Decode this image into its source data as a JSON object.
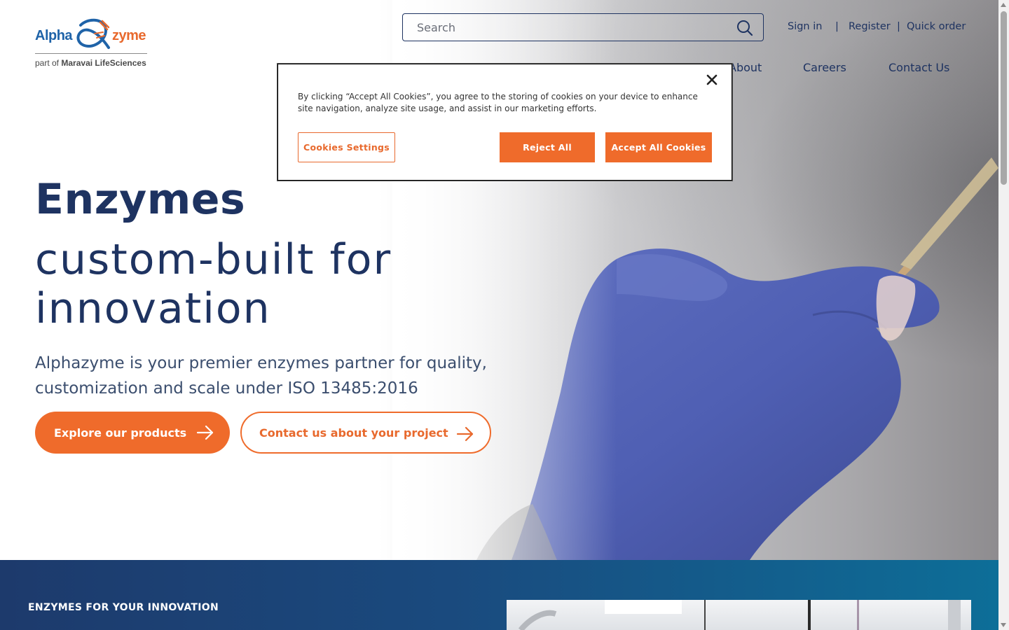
{
  "brand": {
    "logo_left": "Alpha",
    "logo_right": "zyme",
    "tagline_prefix": "part of",
    "tagline_company": "Maravai LifeSciences",
    "primary_color": "#1e3361",
    "accent_color": "#ef6b2b"
  },
  "search": {
    "placeholder": "Search",
    "icon": "search-icon"
  },
  "top_links": {
    "sign_in": "Sign in",
    "separator": "|",
    "register": "Register",
    "quick_order": "Quick order"
  },
  "nav": {
    "about": "About",
    "careers": "Careers",
    "contact_us": "Contact Us"
  },
  "hero": {
    "title": "Enzymes",
    "subtitle": "custom-built for innovation",
    "description": "Alphazyme is your premier enzymes partner for quality, customization and scale under ISO 13485:2016",
    "primary_button": "Explore our products",
    "secondary_button": "Contact us about your project"
  },
  "band": {
    "heading": "ENZYMES FOR YOUR INNOVATION"
  },
  "cookie_banner": {
    "message": "By clicking “Accept All Cookies”, you agree to the storing of cookies on your device to enhance site navigation, analyze site usage, and assist in our marketing efforts.",
    "settings_button": "Cookies Settings",
    "reject_button": "Reject All",
    "accept_button": "Accept All Cookies",
    "close_icon": "close-icon"
  }
}
